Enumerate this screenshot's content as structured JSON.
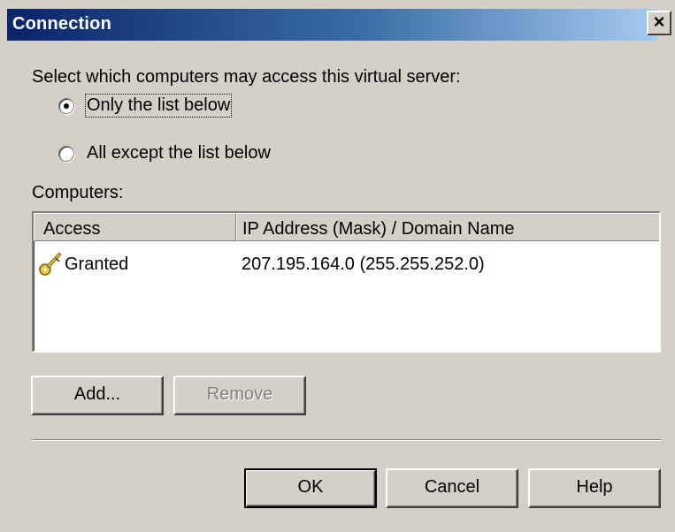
{
  "window": {
    "title": "Connection",
    "close_glyph": "×"
  },
  "prompt": "Select which computers may access this virtual server:",
  "radios": [
    {
      "label": "Only the list below",
      "selected": true
    },
    {
      "label": "All except the list below",
      "selected": false
    }
  ],
  "computers_label": "Computers:",
  "list": {
    "columns": [
      "Access",
      "IP Address (Mask) / Domain Name"
    ],
    "rows": [
      {
        "icon": "key-icon",
        "access": "Granted",
        "address": "207.195.164.0 (255.255.252.0)"
      }
    ]
  },
  "buttons": {
    "add": "Add...",
    "remove": "Remove",
    "ok": "OK",
    "cancel": "Cancel",
    "help": "Help"
  },
  "colors": {
    "title_start": "#0a246a",
    "title_end": "#a6caf0",
    "face": "#d4d0c8"
  }
}
